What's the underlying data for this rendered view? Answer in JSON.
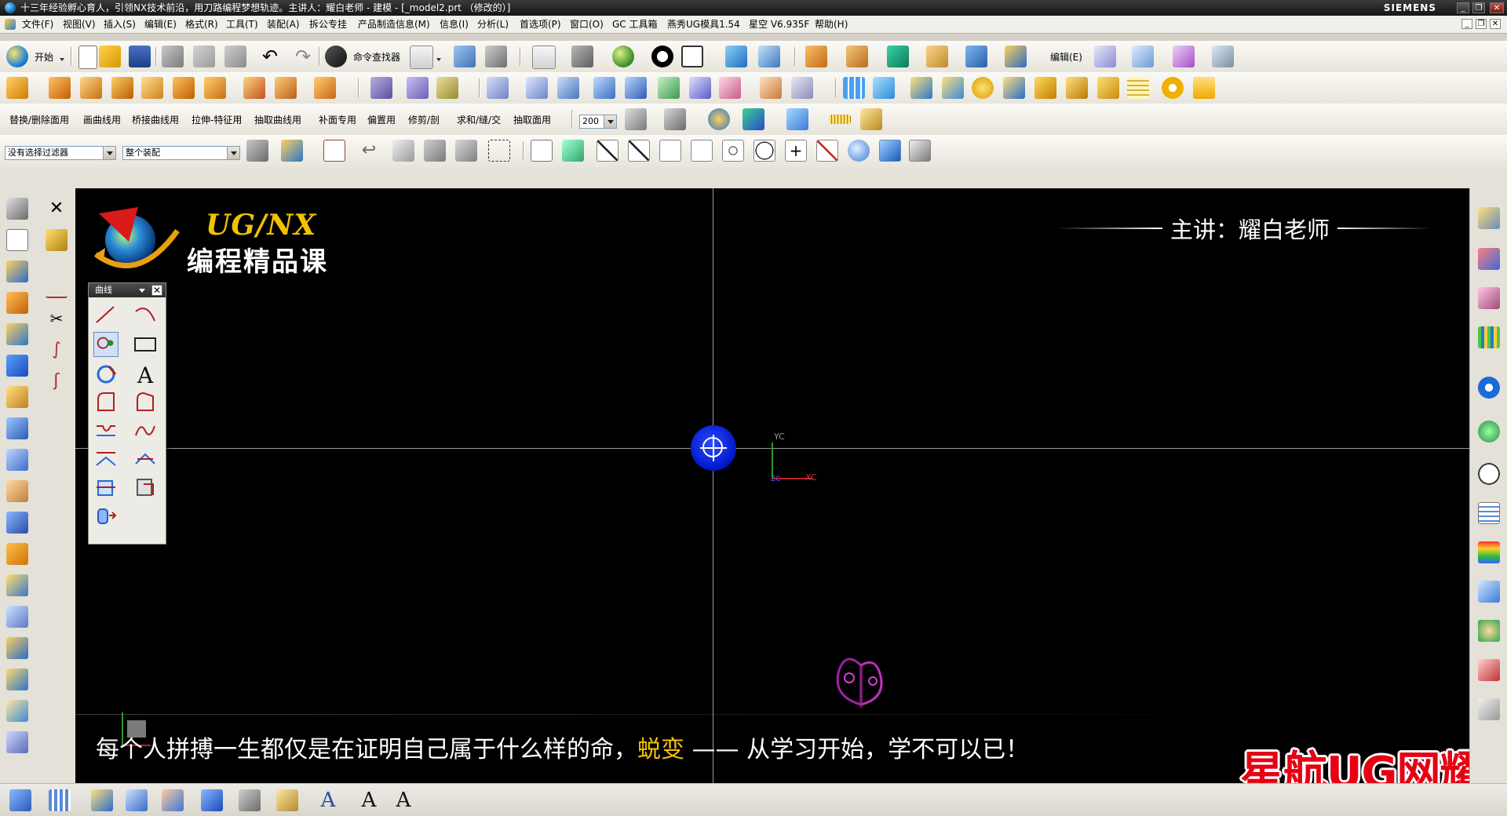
{
  "window": {
    "title": "十三年经验孵心育人，引领NX技术前沿，用刀路编程梦想轨迹。主讲人：耀白老师 - 建模 - [_model2.prt （修改的）]",
    "brand": "SIEMENS",
    "minimize": "_",
    "restore": "❐",
    "close": "✕"
  },
  "menu": {
    "items": [
      "文件(F)",
      "视图(V)",
      "插入(S)",
      "编辑(E)",
      "格式(R)",
      "工具(T)",
      "装配(A)",
      "拆公专挂",
      "产品制造信息(M)",
      "信息(I)",
      "分析(L)",
      "首选项(P)",
      "窗口(O)",
      "GC 工具箱",
      "燕秀UG模具1.54",
      "星空 V6.935F",
      "帮助(H)"
    ],
    "mdi_min": "_",
    "mdi_restore": "❐",
    "mdi_close": "✕"
  },
  "toolbar1": {
    "start_label": "开始",
    "command_finder": "命令查找器",
    "edit_label": "编辑(E)"
  },
  "toolbar3": {
    "labels": [
      "替换/删除面用",
      "画曲线用",
      "桥接曲线用",
      "拉伸-特征用",
      "抽取曲线用",
      "补面专用",
      "偏置用",
      "修剪/剖",
      "求和/缝/交",
      "抽取面用"
    ],
    "zoom_value": "200"
  },
  "selection": {
    "filter": "没有选择过滤器",
    "scope": "整个装配"
  },
  "viewport": {
    "logo_title": "UG/NX",
    "logo_subtitle": "编程精品课",
    "instructor": "主讲：耀白老师",
    "caption_before": "每个人拼搏一生都仅是在证明自己属于什么样的命，",
    "caption_highlight": "蜕变",
    "caption_after": " —— 从学习开始，学不可以已！",
    "watermark": "星航UG网耀白老师",
    "axis_yc": "YC",
    "axis_xc": "XC",
    "axis_zc": "ZC"
  },
  "curve_palette": {
    "title": "曲线",
    "close": "✕",
    "text_tool": "A"
  },
  "bottom": {
    "text_tool_1": "A",
    "text_tool_2": "A",
    "text_tool_3": "A"
  },
  "colors": {
    "accent_yellow": "#f2c200",
    "watermark_red": "#e60012",
    "cursor_blue": "#0016c8"
  }
}
